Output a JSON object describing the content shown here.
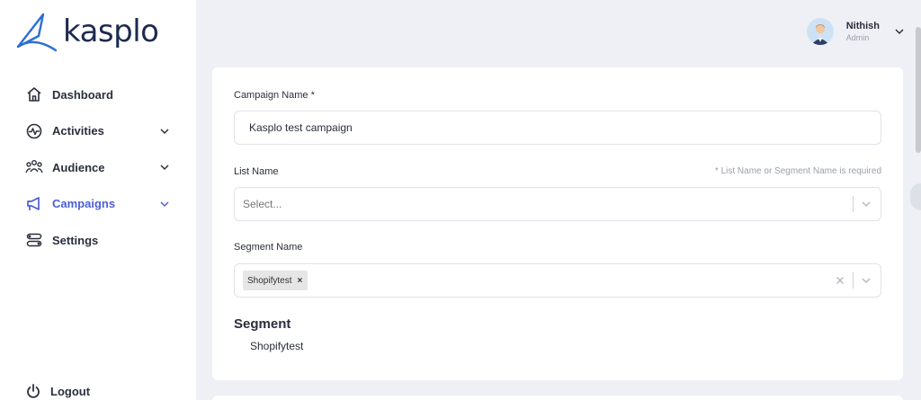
{
  "brand": {
    "name": "kasplo",
    "color": "#1e2b4d",
    "accent": "#4a5fd5"
  },
  "sidebar": {
    "items": [
      {
        "label": "Dashboard",
        "icon": "home-icon",
        "has_chevron": false,
        "active": false
      },
      {
        "label": "Activities",
        "icon": "pulse-icon",
        "has_chevron": true,
        "active": false
      },
      {
        "label": "Audience",
        "icon": "users-icon",
        "has_chevron": true,
        "active": false
      },
      {
        "label": "Campaigns",
        "icon": "megaphone-icon",
        "has_chevron": true,
        "active": true
      },
      {
        "label": "Settings",
        "icon": "toggles-icon",
        "has_chevron": false,
        "active": false
      }
    ],
    "logout_label": "Logout"
  },
  "header": {
    "user_name": "Nithish",
    "user_role": "Admin"
  },
  "form": {
    "campaign_name_label": "Campaign Name *",
    "campaign_name_value": "Kasplo test campaign",
    "list_name_label": "List Name",
    "list_name_hint": "* List Name or Segment Name is required",
    "list_name_placeholder": "Select...",
    "segment_name_label": "Segment Name",
    "segment_tags": [
      "Shopifytest"
    ],
    "segment_section_title": "Segment",
    "segment_section_value": "Shopifytest"
  }
}
